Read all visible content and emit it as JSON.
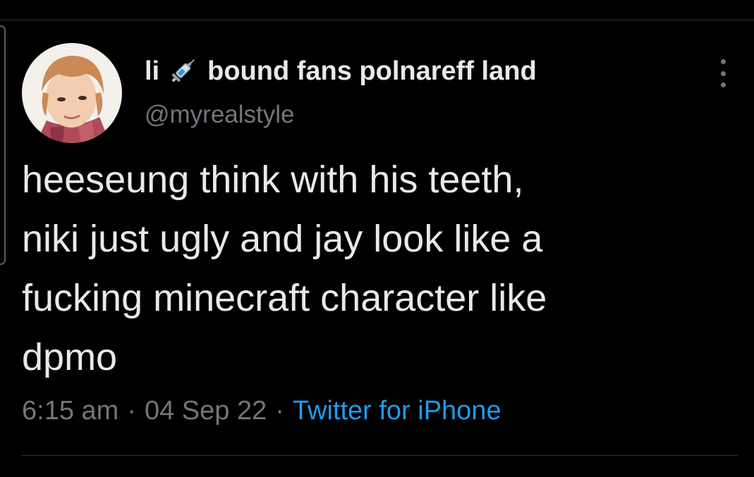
{
  "tweet": {
    "display_name_prefix": "li",
    "display_name_emoji": "syringe-icon",
    "display_name_suffix": "bound fans polnareff land",
    "handle": "@myrealstyle",
    "text_lines": [
      "heeseung think with his teeth,",
      "niki just ugly and jay look like a",
      "fucking minecraft character like",
      "dpmo"
    ],
    "time": "6:15 am",
    "date": "04 Sep 22",
    "separator": "·",
    "source": "Twitter for iPhone"
  },
  "colors": {
    "background": "#000000",
    "text": "#e7e9ea",
    "secondary": "#71767b",
    "link": "#1d9bf0",
    "divider": "#2f3336"
  }
}
